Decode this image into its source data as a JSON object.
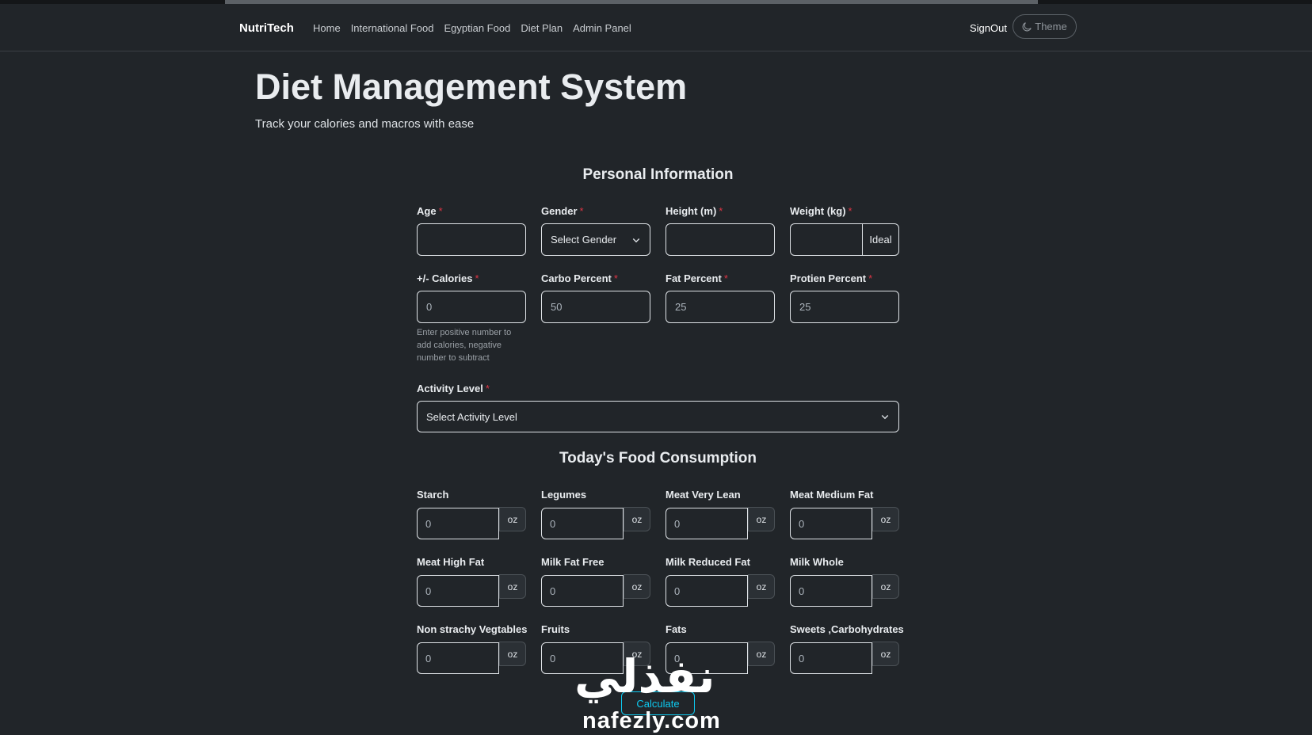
{
  "nav": {
    "brand": "NutriTech",
    "links": [
      "Home",
      "International Food",
      "Egyptian Food",
      "Diet Plan",
      "Admin Panel"
    ],
    "signout": "SignOut",
    "theme": "Theme"
  },
  "hero": {
    "title": "Diet Management System",
    "subtitle": "Track your calories and macros with ease"
  },
  "personal": {
    "title": "Personal Information",
    "required_mark": "*",
    "age": {
      "label": "Age",
      "value": ""
    },
    "gender": {
      "label": "Gender",
      "value": "Select Gender"
    },
    "height": {
      "label": "Height (m)",
      "value": ""
    },
    "weight": {
      "label": "Weight (kg)",
      "value": "",
      "button": "Ideal"
    },
    "calories": {
      "label": "+/- Calories",
      "value": "0",
      "help": "Enter positive number to add calories, negative number to subtract"
    },
    "carbo": {
      "label": "Carbo Percent",
      "value": "50"
    },
    "fat": {
      "label": "Fat Percent",
      "value": "25"
    },
    "protein": {
      "label": "Protien Percent",
      "value": "25"
    },
    "activity": {
      "label": "Activity Level",
      "value": "Select Activity Level"
    }
  },
  "food": {
    "title": "Today's Food Consumption",
    "unit": "oz",
    "items": [
      {
        "label": "Starch",
        "value": "0"
      },
      {
        "label": "Legumes",
        "value": "0"
      },
      {
        "label": "Meat Very Lean",
        "value": "0"
      },
      {
        "label": "Meat Medium Fat",
        "value": "0"
      },
      {
        "label": "Meat High Fat",
        "value": "0"
      },
      {
        "label": "Milk Fat Free",
        "value": "0"
      },
      {
        "label": "Milk Reduced Fat",
        "value": "0"
      },
      {
        "label": "Milk Whole",
        "value": "0"
      },
      {
        "label": "Non strachy Vegtables",
        "value": "0"
      },
      {
        "label": "Fruits",
        "value": "0"
      },
      {
        "label": "Fats",
        "value": "0"
      },
      {
        "label": "Sweets ,Carbohydrates",
        "value": "0"
      }
    ],
    "calculate": "Calculate"
  },
  "watermark": {
    "arabic": "نفذلي",
    "latin": "nafezly.com"
  },
  "colors": {
    "background": "#212529",
    "accent": "#0dcaf0",
    "required": "#dc3545"
  }
}
